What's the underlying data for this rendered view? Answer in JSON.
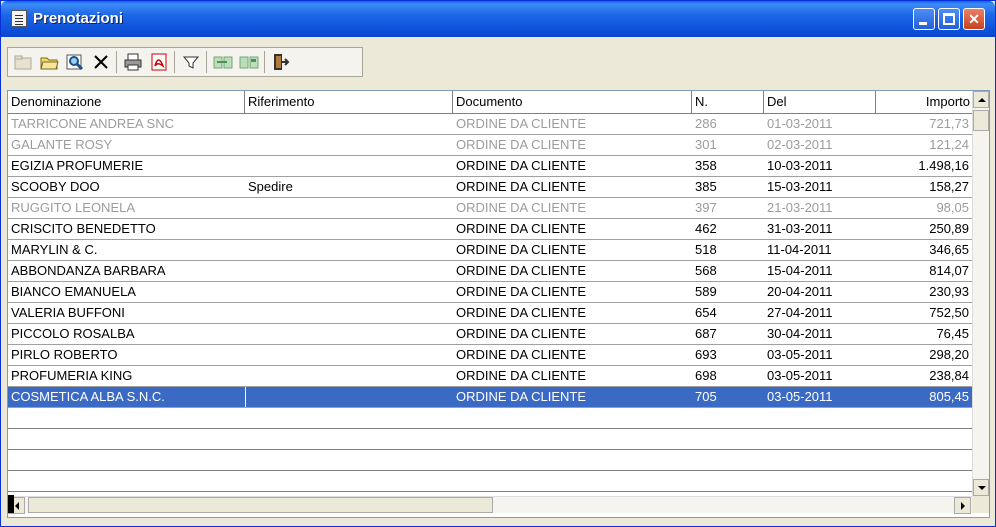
{
  "window": {
    "title": "Prenotazioni"
  },
  "toolbar": {
    "tools": [
      "new-record-icon",
      "open-folder-icon",
      "search-icon",
      "delete-icon",
      "print-icon",
      "pdf-icon",
      "filter-icon",
      "import-icon",
      "export-icon",
      "exit-icon"
    ]
  },
  "columns": [
    "Denominazione",
    "Riferimento",
    "Documento",
    "N.",
    "Del",
    "Importo"
  ],
  "rows": [
    {
      "den": "TARRICONE ANDREA SNC",
      "rif": "",
      "doc": "ORDINE DA CLIENTE",
      "n": "286",
      "del": "01-03-2011",
      "imp": "721,73",
      "state": "dim"
    },
    {
      "den": "GALANTE ROSY",
      "rif": "",
      "doc": "ORDINE DA CLIENTE",
      "n": "301",
      "del": "02-03-2011",
      "imp": "121,24",
      "state": "dim"
    },
    {
      "den": "EGIZIA PROFUMERIE",
      "rif": "",
      "doc": "ORDINE DA CLIENTE",
      "n": "358",
      "del": "10-03-2011",
      "imp": "1.498,16",
      "state": "normal"
    },
    {
      "den": "SCOOBY DOO",
      "rif": "Spedire",
      "doc": "ORDINE DA CLIENTE",
      "n": "385",
      "del": "15-03-2011",
      "imp": "158,27",
      "state": "normal"
    },
    {
      "den": "RUGGITO LEONELA",
      "rif": "",
      "doc": "ORDINE DA CLIENTE",
      "n": "397",
      "del": "21-03-2011",
      "imp": "98,05",
      "state": "dim"
    },
    {
      "den": "CRISCITO BENEDETTO",
      "rif": "",
      "doc": "ORDINE DA CLIENTE",
      "n": "462",
      "del": "31-03-2011",
      "imp": "250,89",
      "state": "normal"
    },
    {
      "den": "MARYLIN & C.",
      "rif": "",
      "doc": "ORDINE DA CLIENTE",
      "n": "518",
      "del": "11-04-2011",
      "imp": "346,65",
      "state": "normal"
    },
    {
      "den": "ABBONDANZA BARBARA",
      "rif": "",
      "doc": "ORDINE DA CLIENTE",
      "n": "568",
      "del": "15-04-2011",
      "imp": "814,07",
      "state": "normal"
    },
    {
      "den": "BIANCO EMANUELA",
      "rif": "",
      "doc": "ORDINE DA CLIENTE",
      "n": "589",
      "del": "20-04-2011",
      "imp": "230,93",
      "state": "normal"
    },
    {
      "den": "VALERIA BUFFONI",
      "rif": "",
      "doc": "ORDINE DA CLIENTE",
      "n": "654",
      "del": "27-04-2011",
      "imp": "752,50",
      "state": "normal"
    },
    {
      "den": "PICCOLO ROSALBA",
      "rif": "",
      "doc": "ORDINE DA CLIENTE",
      "n": "687",
      "del": "30-04-2011",
      "imp": "76,45",
      "state": "normal"
    },
    {
      "den": "PIRLO ROBERTO",
      "rif": "",
      "doc": "ORDINE DA CLIENTE",
      "n": "693",
      "del": "03-05-2011",
      "imp": "298,20",
      "state": "normal"
    },
    {
      "den": "PROFUMERIA KING",
      "rif": "",
      "doc": "ORDINE DA CLIENTE",
      "n": "698",
      "del": "03-05-2011",
      "imp": "238,84",
      "state": "normal"
    },
    {
      "den": "COSMETICA ALBA S.N.C.",
      "rif": "",
      "doc": "ORDINE DA CLIENTE",
      "n": "705",
      "del": "03-05-2011",
      "imp": "805,45",
      "state": "selected"
    }
  ],
  "colors": {
    "title_bar": "#0b4fd8",
    "selection": "#3b6ac4",
    "dimmed_text": "#9c9c9c"
  }
}
